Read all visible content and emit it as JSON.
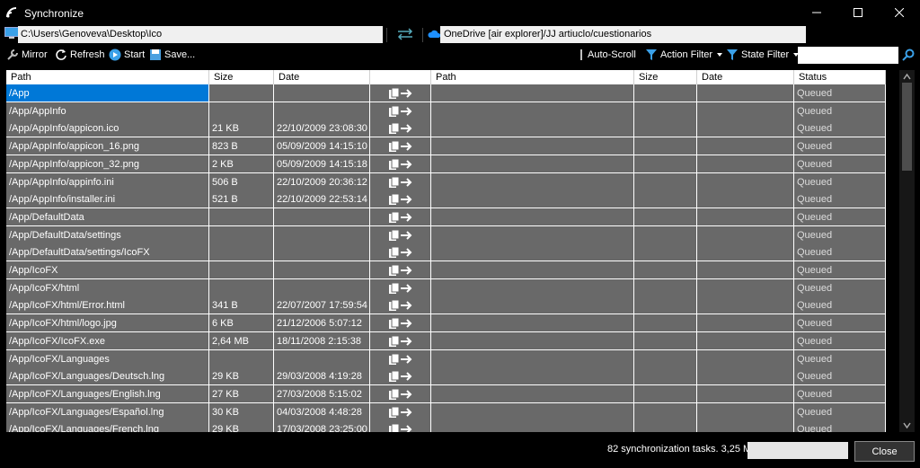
{
  "window": {
    "title": "Synchronize"
  },
  "paths": {
    "local": "C:\\Users\\Genoveva\\Desktop\\Ico",
    "remote": "OneDrive [air explorer]/JJ artiuclo/cuestionarios"
  },
  "toolbar": {
    "mirror": "Mirror",
    "refresh": "Refresh",
    "start": "Start",
    "save": "Save...",
    "auto_scroll": "Auto-Scroll",
    "action_filter": "Action Filter",
    "state_filter": "State Filter",
    "search_value": ""
  },
  "columns": {
    "left_path": "Path",
    "left_size": "Size",
    "left_date": "Date",
    "right_path": "Path",
    "right_size": "Size",
    "right_date": "Date",
    "status": "Status"
  },
  "rows": [
    {
      "path": "/App",
      "size": "",
      "date": "",
      "status": "Queued",
      "selected": true
    },
    {
      "path": "/App/AppInfo",
      "size": "",
      "date": "",
      "status": "Queued"
    },
    {
      "path": "/App/AppInfo/appicon.ico",
      "size": "21 KB",
      "date": "22/10/2009 23:08:30",
      "status": "Queued"
    },
    {
      "path": "/App/AppInfo/appicon_16.png",
      "size": "823 B",
      "date": "05/09/2009 14:15:10",
      "status": "Queued"
    },
    {
      "path": "/App/AppInfo/appicon_32.png",
      "size": "2 KB",
      "date": "05/09/2009 14:15:18",
      "status": "Queued"
    },
    {
      "path": "/App/AppInfo/appinfo.ini",
      "size": "506 B",
      "date": "22/10/2009 20:36:12",
      "status": "Queued"
    },
    {
      "path": "/App/AppInfo/installer.ini",
      "size": "521 B",
      "date": "22/10/2009 22:53:14",
      "status": "Queued"
    },
    {
      "path": "/App/DefaultData",
      "size": "",
      "date": "",
      "status": "Queued"
    },
    {
      "path": "/App/DefaultData/settings",
      "size": "",
      "date": "",
      "status": "Queued"
    },
    {
      "path": "/App/DefaultData/settings/IcoFX",
      "size": "",
      "date": "",
      "status": "Queued"
    },
    {
      "path": "/App/IcoFX",
      "size": "",
      "date": "",
      "status": "Queued"
    },
    {
      "path": "/App/IcoFX/html",
      "size": "",
      "date": "",
      "status": "Queued"
    },
    {
      "path": "/App/IcoFX/html/Error.html",
      "size": "341 B",
      "date": "22/07/2007 17:59:54",
      "status": "Queued"
    },
    {
      "path": "/App/IcoFX/html/logo.jpg",
      "size": "6 KB",
      "date": "21/12/2006 5:07:12",
      "status": "Queued"
    },
    {
      "path": "/App/IcoFX/IcoFX.exe",
      "size": "2,64 MB",
      "date": "18/11/2008 2:15:38",
      "status": "Queued"
    },
    {
      "path": "/App/IcoFX/Languages",
      "size": "",
      "date": "",
      "status": "Queued"
    },
    {
      "path": "/App/IcoFX/Languages/Deutsch.lng",
      "size": "29 KB",
      "date": "29/03/2008 4:19:28",
      "status": "Queued"
    },
    {
      "path": "/App/IcoFX/Languages/English.lng",
      "size": "27 KB",
      "date": "27/03/2008 5:15:02",
      "status": "Queued"
    },
    {
      "path": "/App/IcoFX/Languages/Español.lng",
      "size": "30 KB",
      "date": "04/03/2008 4:48:28",
      "status": "Queued"
    },
    {
      "path": "/App/IcoFX/Languages/French.lng",
      "size": "29 KB",
      "date": "17/03/2008 23:25:00",
      "status": "Queued"
    }
  ],
  "footer": {
    "summary": "82 synchronization tasks. 3,25 MB",
    "close": "Close"
  },
  "icons": {
    "app": "sync-app-icon",
    "local": "computer-icon",
    "swap": "swap-arrows-icon",
    "remote": "onedrive-cloud-icon",
    "action": "copy-right-arrow-icon"
  },
  "colors": {
    "accent": "#0078d7",
    "row_bg": "#696969",
    "window_bg": "#000000"
  }
}
